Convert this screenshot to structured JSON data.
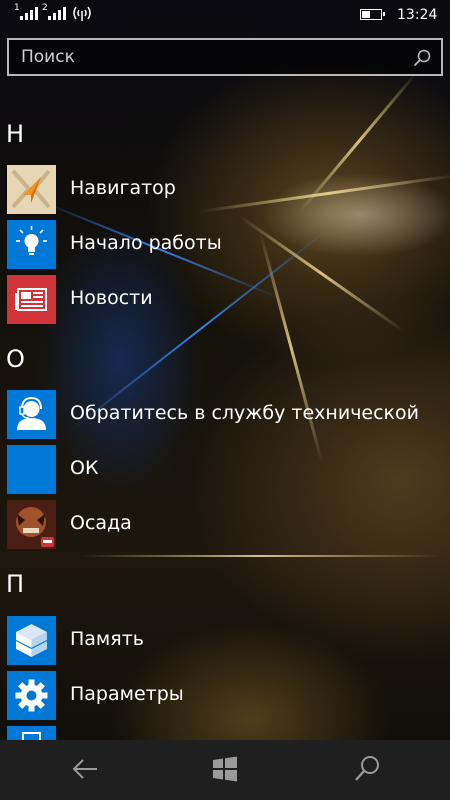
{
  "status_bar": {
    "sim1": "1",
    "sim2": "2",
    "time": "13:24"
  },
  "search": {
    "placeholder": "Поиск"
  },
  "sections": [
    {
      "letter": "Н",
      "apps": [
        {
          "label": "Навигатор",
          "icon": "navigator-icon",
          "color": "#e8dcc0"
        },
        {
          "label": "Начало работы",
          "icon": "lightbulb-icon",
          "color": "#0078d7"
        },
        {
          "label": "Новости",
          "icon": "news-icon",
          "color": "#d13438"
        }
      ]
    },
    {
      "letter": "О",
      "apps": [
        {
          "label": "Обратитесь в службу технической",
          "icon": "support-person-icon",
          "color": "#0078d7"
        },
        {
          "label": "ОК",
          "icon": "ok-icon",
          "color": "#0078d7"
        },
        {
          "label": "Осада",
          "icon": "game-icon",
          "color": "#6a2a1a"
        }
      ]
    },
    {
      "letter": "П",
      "apps": [
        {
          "label": "Память",
          "icon": "storage-cube-icon",
          "color": "#0078d7"
        },
        {
          "label": "Параметры",
          "icon": "gear-icon",
          "color": "#0078d7"
        }
      ]
    }
  ],
  "nav_bar": {
    "back_icon": "back-arrow-icon",
    "home_icon": "windows-logo-icon",
    "search_icon": "search-icon"
  }
}
